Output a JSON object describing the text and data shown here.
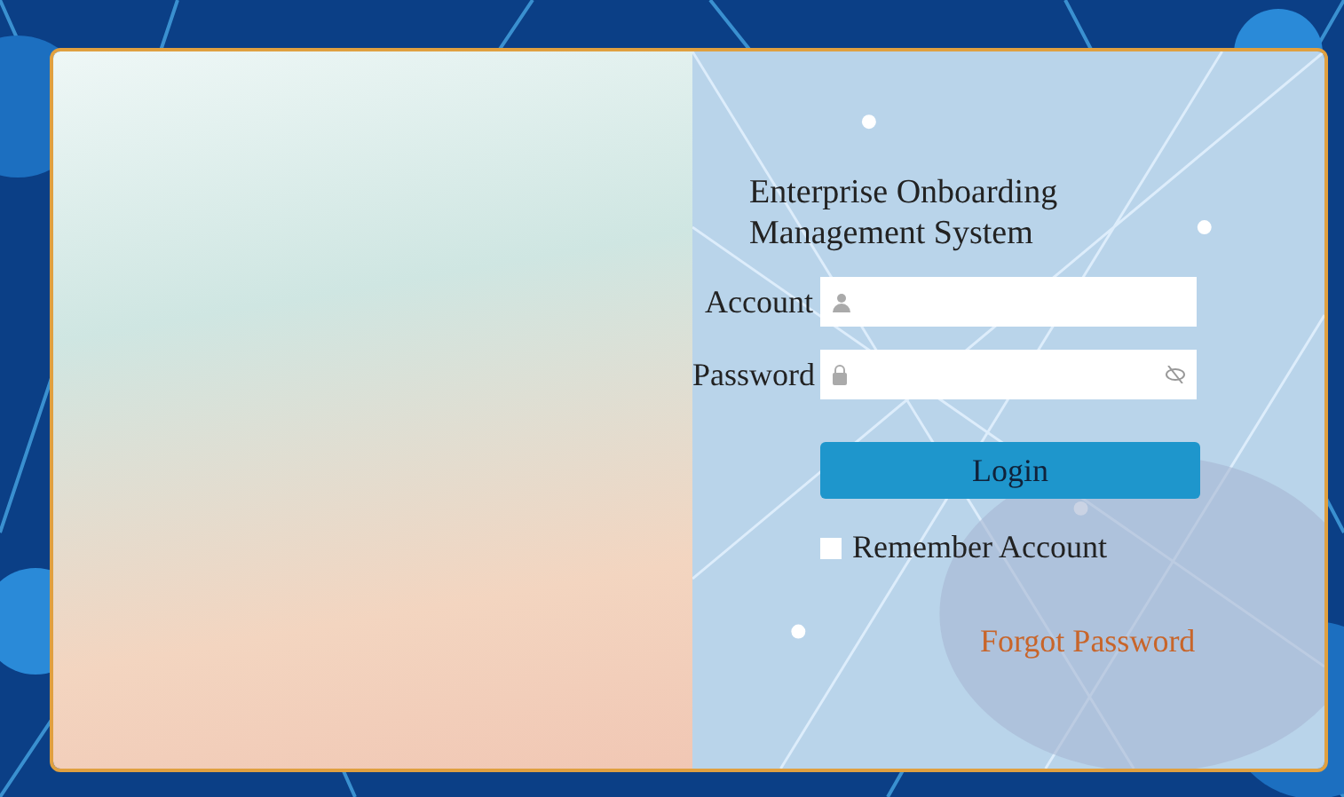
{
  "title": "Enterprise Onboarding Management System",
  "fields": [
    {
      "label": "Account",
      "kind": "text"
    },
    {
      "label": "Password",
      "kind": "password"
    }
  ],
  "login_button": "Login",
  "remember": {
    "label": "Remember Account",
    "checked": false
  },
  "forgot_link": "Forgot Password"
}
